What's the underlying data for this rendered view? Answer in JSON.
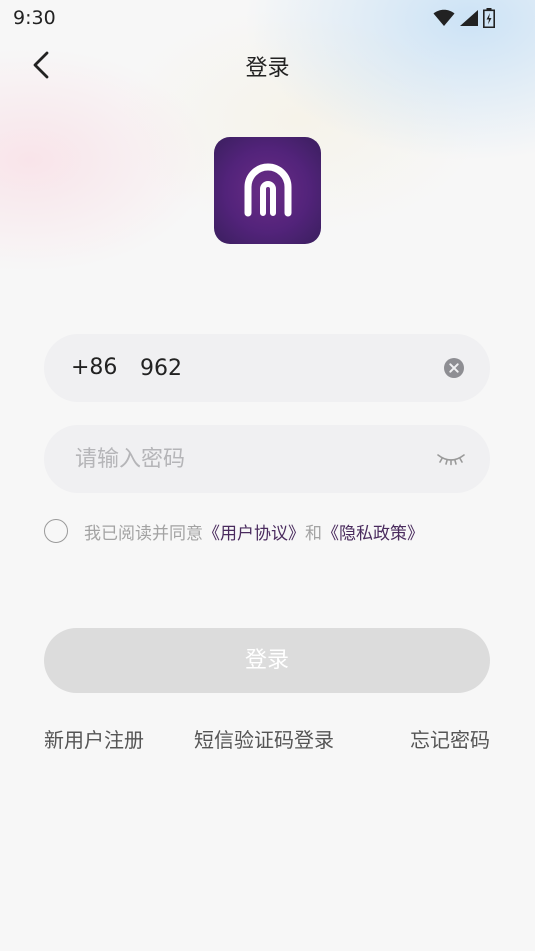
{
  "status_bar": {
    "time": "9:30",
    "icons": [
      "wifi-icon",
      "cellular-signal-icon",
      "battery-icon"
    ]
  },
  "header": {
    "title": "登录",
    "back_icon": "chevron-left-icon"
  },
  "logo": {
    "icon": "app-logo-arch-icon",
    "bg_color": "#52237a"
  },
  "phone_field": {
    "country_code": "+86",
    "value": "962",
    "clear_icon": "clear-circle-icon"
  },
  "password_field": {
    "placeholder": "请输入密码",
    "toggle_icon": "eye-closed-icon"
  },
  "agreement": {
    "prefix": "我已阅读并同意",
    "user_agreement": "《用户协议》",
    "conjunction": "和",
    "privacy_policy": "《隐私政策》",
    "checked": false
  },
  "login_button": {
    "label": "登录",
    "enabled": false
  },
  "links": {
    "register": "新用户注册",
    "sms_login": "短信验证码登录",
    "forgot_password": "忘记密码"
  },
  "colors": {
    "accent": "#4a2b5e",
    "button_disabled": "#dcdcdc",
    "field_bg": "#f0f0f2"
  }
}
